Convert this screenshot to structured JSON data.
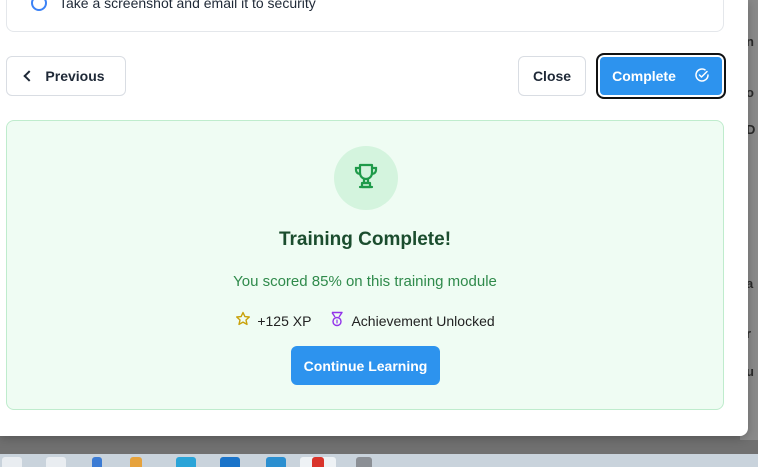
{
  "option": {
    "label": "Take a screenshot and email it to security"
  },
  "nav": {
    "previous_label": "Previous",
    "close_label": "Close",
    "complete_label": "Complete"
  },
  "result": {
    "title": "Training Complete!",
    "score_text": "You scored 85% on this training module",
    "xp_text": "+125 XP",
    "achievement_text": "Achievement Unlocked",
    "continue_label": "Continue Learning"
  },
  "colors": {
    "accent": "#2d93ee",
    "success_bg": "#effcf3",
    "success_text": "#2f8a4b",
    "trophy": "#1f9a4a"
  },
  "icons": {
    "trophy": "trophy-icon",
    "star": "star-icon",
    "medal": "medal-icon",
    "complete_check": "check-circle-icon",
    "previous": "chevron-left-icon"
  }
}
